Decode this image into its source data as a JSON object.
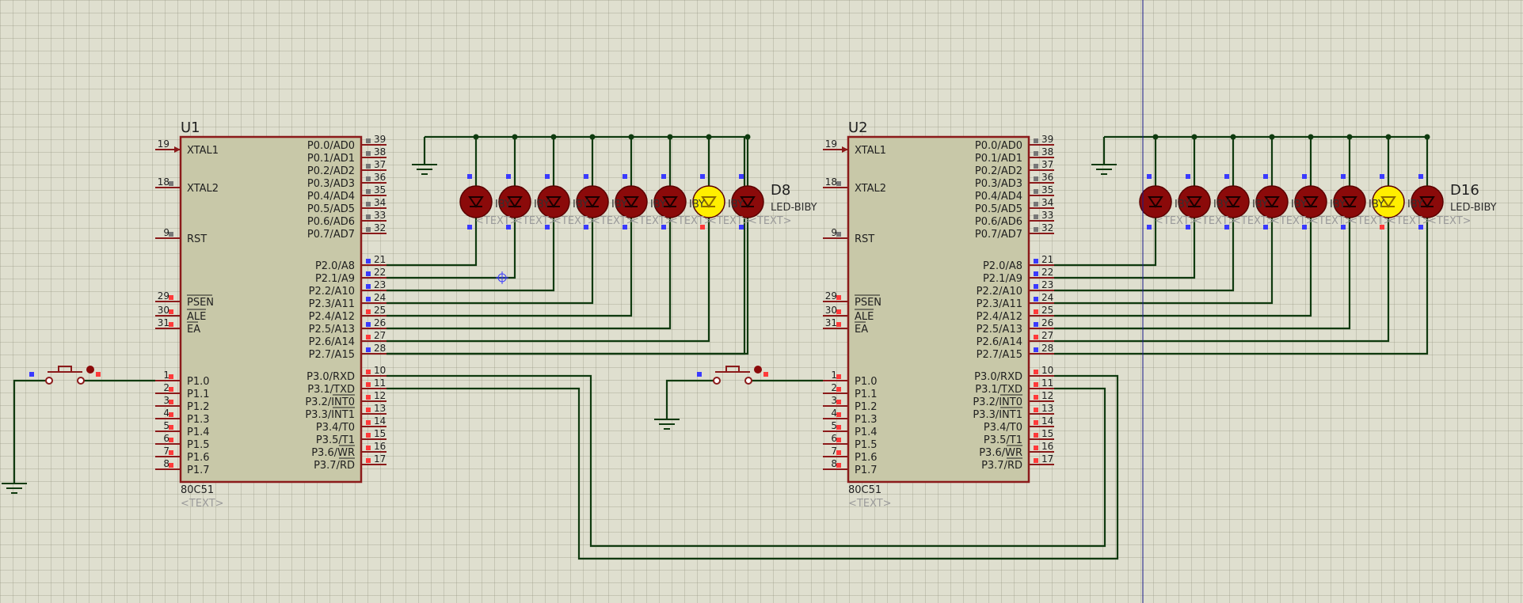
{
  "chips": [
    {
      "ref": "U1",
      "part": "80C51",
      "text_placeholder": "<TEXT>",
      "left_pins": [
        {
          "num": "19",
          "name": "XTAL1"
        },
        {
          "num": "18",
          "name": "XTAL2"
        },
        {
          "num": "9",
          "name": "RST"
        },
        {
          "num": "29",
          "name": "PSEN"
        },
        {
          "num": "30",
          "name": "ALE"
        },
        {
          "num": "31",
          "name": "EA"
        },
        {
          "num": "1",
          "name": "P1.0"
        },
        {
          "num": "2",
          "name": "P1.1"
        },
        {
          "num": "3",
          "name": "P1.2"
        },
        {
          "num": "4",
          "name": "P1.3"
        },
        {
          "num": "5",
          "name": "P1.4"
        },
        {
          "num": "6",
          "name": "P1.5"
        },
        {
          "num": "7",
          "name": "P1.6"
        },
        {
          "num": "8",
          "name": "P1.7"
        }
      ],
      "right_pins": [
        {
          "num": "39",
          "name": "P0.0/AD0"
        },
        {
          "num": "38",
          "name": "P0.1/AD1"
        },
        {
          "num": "37",
          "name": "P0.2/AD2"
        },
        {
          "num": "36",
          "name": "P0.3/AD3"
        },
        {
          "num": "35",
          "name": "P0.4/AD4"
        },
        {
          "num": "34",
          "name": "P0.5/AD5"
        },
        {
          "num": "33",
          "name": "P0.6/AD6"
        },
        {
          "num": "32",
          "name": "P0.7/AD7"
        },
        {
          "num": "21",
          "name": "P2.0/A8"
        },
        {
          "num": "22",
          "name": "P2.1/A9"
        },
        {
          "num": "23",
          "name": "P2.2/A10"
        },
        {
          "num": "24",
          "name": "P2.3/A11"
        },
        {
          "num": "25",
          "name": "P2.4/A12"
        },
        {
          "num": "26",
          "name": "P2.5/A13"
        },
        {
          "num": "27",
          "name": "P2.6/A14"
        },
        {
          "num": "28",
          "name": "P2.7/A15"
        },
        {
          "num": "10",
          "name": "P3.0/RXD"
        },
        {
          "num": "11",
          "name": "P3.1/TXD"
        },
        {
          "num": "12",
          "name": "P3.2/INT0"
        },
        {
          "num": "13",
          "name": "P3.3/INT1"
        },
        {
          "num": "14",
          "name": "P3.4/T0"
        },
        {
          "num": "15",
          "name": "P3.5/T1"
        },
        {
          "num": "16",
          "name": "P3.6/WR"
        },
        {
          "num": "17",
          "name": "P3.7/RD"
        }
      ]
    },
    {
      "ref": "U2",
      "part": "80C51",
      "text_placeholder": "<TEXT>",
      "left_pins": [
        {
          "num": "19",
          "name": "XTAL1"
        },
        {
          "num": "18",
          "name": "XTAL2"
        },
        {
          "num": "9",
          "name": "RST"
        },
        {
          "num": "29",
          "name": "PSEN"
        },
        {
          "num": "30",
          "name": "ALE"
        },
        {
          "num": "31",
          "name": "EA"
        },
        {
          "num": "1",
          "name": "P1.0"
        },
        {
          "num": "2",
          "name": "P1.1"
        },
        {
          "num": "3",
          "name": "P1.2"
        },
        {
          "num": "4",
          "name": "P1.3"
        },
        {
          "num": "5",
          "name": "P1.4"
        },
        {
          "num": "6",
          "name": "P1.5"
        },
        {
          "num": "7",
          "name": "P1.6"
        },
        {
          "num": "8",
          "name": "P1.7"
        }
      ],
      "right_pins": [
        {
          "num": "39",
          "name": "P0.0/AD0"
        },
        {
          "num": "38",
          "name": "P0.1/AD1"
        },
        {
          "num": "37",
          "name": "P0.2/AD2"
        },
        {
          "num": "36",
          "name": "P0.3/AD3"
        },
        {
          "num": "35",
          "name": "P0.4/AD4"
        },
        {
          "num": "34",
          "name": "P0.5/AD5"
        },
        {
          "num": "33",
          "name": "P0.6/AD6"
        },
        {
          "num": "32",
          "name": "P0.7/AD7"
        },
        {
          "num": "21",
          "name": "P2.0/A8"
        },
        {
          "num": "22",
          "name": "P2.1/A9"
        },
        {
          "num": "23",
          "name": "P2.2/A10"
        },
        {
          "num": "24",
          "name": "P2.3/A11"
        },
        {
          "num": "25",
          "name": "P2.4/A12"
        },
        {
          "num": "26",
          "name": "P2.5/A13"
        },
        {
          "num": "27",
          "name": "P2.6/A14"
        },
        {
          "num": "28",
          "name": "P2.7/A15"
        },
        {
          "num": "10",
          "name": "P3.0/RXD"
        },
        {
          "num": "11",
          "name": "P3.1/TXD"
        },
        {
          "num": "12",
          "name": "P3.2/INT0"
        },
        {
          "num": "13",
          "name": "P3.3/INT1"
        },
        {
          "num": "14",
          "name": "P3.4/T0"
        },
        {
          "num": "15",
          "name": "P3.5/T1"
        },
        {
          "num": "16",
          "name": "P3.6/WR"
        },
        {
          "num": "17",
          "name": "P3.7/RD"
        }
      ]
    }
  ],
  "led_banks": [
    {
      "last_ref": "D8",
      "part": "LED-BIBY",
      "text_placeholder": "<TEXT>",
      "lit_index": 6,
      "count": 8
    },
    {
      "last_ref": "D16",
      "part": "LED-BIBY",
      "text_placeholder": "<TEXT>",
      "lit_index": 6,
      "count": 8
    }
  ],
  "colors": {
    "background": "#dfdfcf",
    "chip_fill": "#c8c8a8",
    "chip_border": "#8b1a1a",
    "wire": "#0f3a0f",
    "led_off": "#8b0a0a",
    "led_on": "#ffee00",
    "pin_blue": "#3a3aff",
    "pin_red": "#ff3a3a",
    "cursor_line": "#1a1a8a"
  },
  "icons": [
    "ground-icon",
    "push-button-icon",
    "led-icon",
    "probe-cursor-icon"
  ]
}
